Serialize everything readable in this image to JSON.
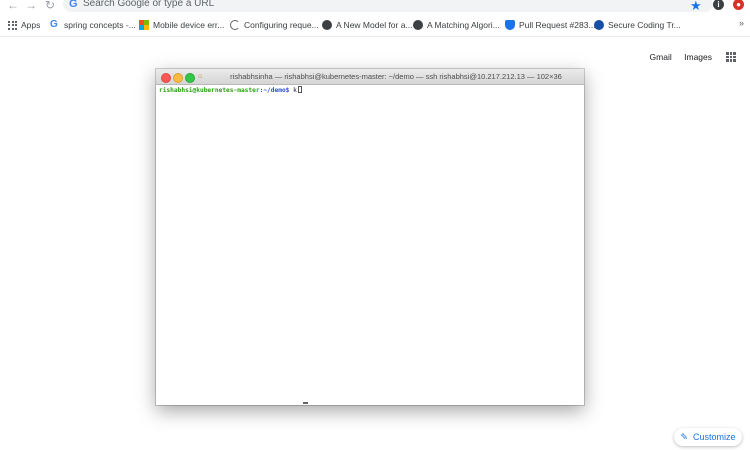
{
  "browser": {
    "omnibox_placeholder": "Search Google or type a URL",
    "accent": "#1a73e8"
  },
  "bookmarks": [
    {
      "label": "Apps",
      "icon": "apps-grid-icon"
    },
    {
      "label": "spring concepts -...",
      "icon": "google-g-icon"
    },
    {
      "label": "Mobile device err...",
      "icon": "microsoft-logo-icon"
    },
    {
      "label": "Configuring reque...",
      "icon": "loading-icon"
    },
    {
      "label": "A New Model for a...",
      "icon": "globe-icon"
    },
    {
      "label": "A Matching Algori...",
      "icon": "globe-icon"
    },
    {
      "label": "Pull Request #283...",
      "icon": "shield-icon"
    },
    {
      "label": "Secure Coding Tr...",
      "icon": "bookmark-circle-icon"
    }
  ],
  "google_links": {
    "gmail": "Gmail",
    "images": "Images"
  },
  "terminal": {
    "title": "rishabhsinha — rishabhsi@kubernetes-master: ~/demo — ssh rishabhsi@10.217.212.13 — 102×36",
    "prompt_user": "rishabhsi@kubernetes-master",
    "prompt_path": ":~/demo$",
    "command": " k"
  },
  "customize": {
    "label": "Customize"
  }
}
